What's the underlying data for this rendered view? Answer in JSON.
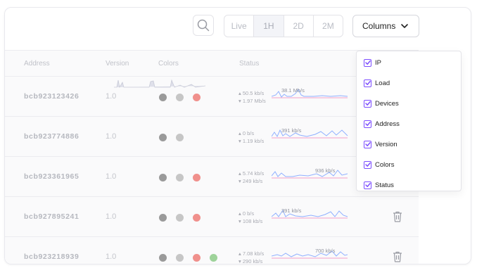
{
  "toolbar": {
    "range_options": [
      "Live",
      "1H",
      "2D",
      "2M"
    ],
    "active_range": "1H",
    "columns_label": "Columns"
  },
  "table": {
    "headers": {
      "address": "Address",
      "version": "Version",
      "colors": "Colors",
      "status": "Status"
    },
    "rows": [
      {
        "address": "bcb923123426",
        "version": "1.0",
        "up": "50.5 kb/s",
        "down": "1.97 Mb/s",
        "peak": "38.1 Mb/s",
        "dots": [
          "#9a9a9a",
          "#c6c6c6",
          "#f0908c"
        ]
      },
      {
        "address": "bcb923774886",
        "version": "1.0",
        "up": "0 b/s",
        "down": "1.19 kb/s",
        "peak": "391 kb/s",
        "dots": [
          "#9a9a9a",
          "#c6c6c6"
        ]
      },
      {
        "address": "bcb923361965",
        "version": "1.0",
        "up": "5.74 kb/s",
        "down": "249 kb/s",
        "peak": "936 kb/s",
        "dots": [
          "#9a9a9a",
          "#c6c6c6",
          "#f0908c"
        ]
      },
      {
        "address": "bcb927895241",
        "version": "1.0",
        "up": "0 b/s",
        "down": "108 kb/s",
        "peak": "391 kb/s",
        "dots": [
          "#9a9a9a",
          "#c6c6c6",
          "#f0908c"
        ]
      },
      {
        "address": "bcb923218939",
        "version": "1.0",
        "up": "7.08 kb/s",
        "down": "290 kb/s",
        "peak": "700 kb/s",
        "dots": [
          "#9a9a9a",
          "#c6c6c6",
          "#f0908c",
          "#9ed39a"
        ]
      }
    ]
  },
  "columns_menu": {
    "items": [
      {
        "label": "IP",
        "checked": true
      },
      {
        "label": "Load",
        "checked": true
      },
      {
        "label": "Devices",
        "checked": true
      },
      {
        "label": "Address",
        "checked": true
      },
      {
        "label": "Version",
        "checked": true
      },
      {
        "label": "Colors",
        "checked": true
      },
      {
        "label": "Status",
        "checked": true
      }
    ]
  },
  "colors": {
    "accent": "#7c4dff",
    "spark_up": "#8fb0ff",
    "spark_down": "#f3a0c8"
  }
}
